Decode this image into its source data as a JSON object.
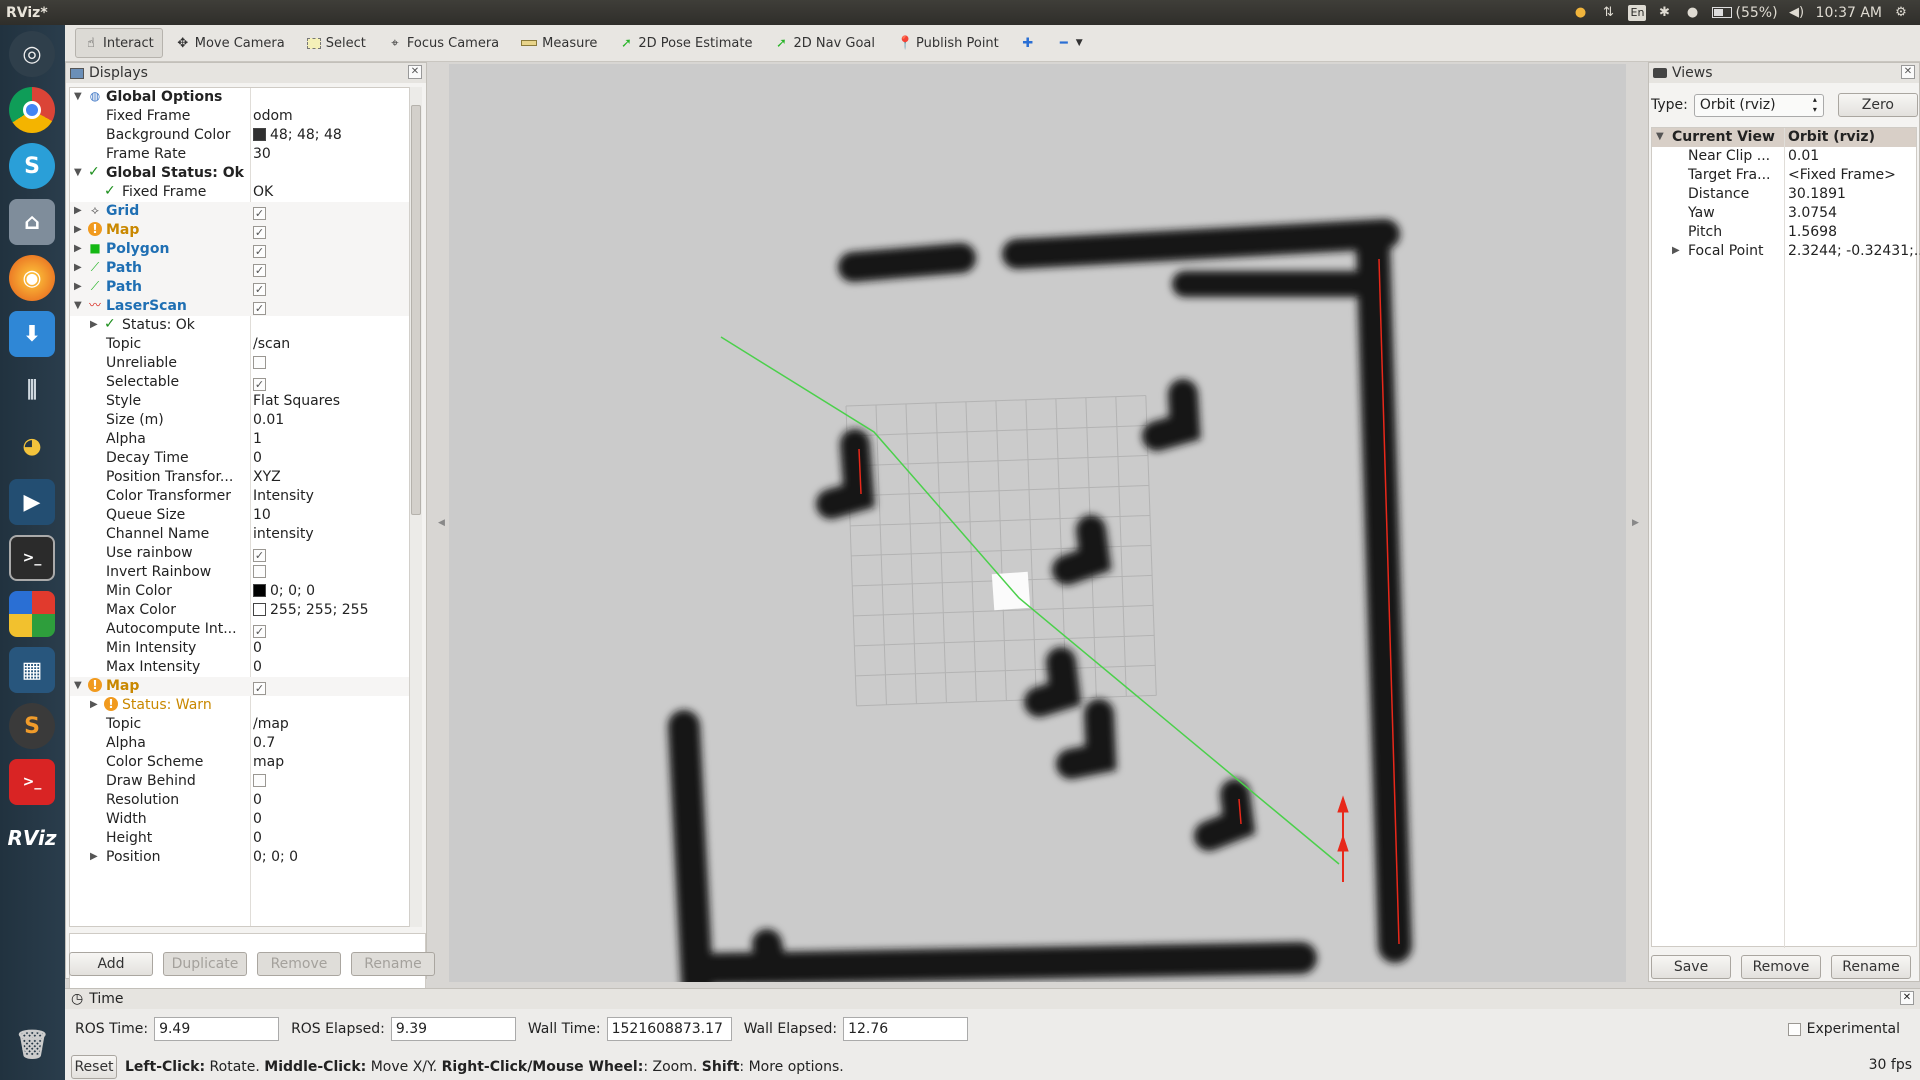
{
  "app_title": "RViz*",
  "tray": {
    "battery": "(55%)",
    "clock": "10:37 AM",
    "keyboard": "En"
  },
  "toolbar": {
    "tools": [
      {
        "label": "Interact",
        "icon": "hand-pointer-icon",
        "active": true
      },
      {
        "label": "Move Camera",
        "icon": "move-arrows-icon"
      },
      {
        "label": "Select",
        "icon": "select-box-icon"
      },
      {
        "label": "Focus Camera",
        "icon": "crosshair-icon"
      },
      {
        "label": "Measure",
        "icon": "ruler-icon"
      },
      {
        "label": "2D Pose Estimate",
        "icon": "green-arrow-icon"
      },
      {
        "label": "2D Nav Goal",
        "icon": "green-arrow-icon"
      },
      {
        "label": "Publish Point",
        "icon": "map-pin-icon"
      }
    ]
  },
  "displays": {
    "title": "Displays",
    "rows": [
      {
        "indent": 0,
        "arrow": "▼",
        "icon": "globe-icon",
        "name": "Global Options",
        "val": "",
        "cls": ""
      },
      {
        "indent": 1,
        "name": "Fixed Frame",
        "val": "odom"
      },
      {
        "indent": 1,
        "name": "Background Color",
        "val": "48; 48; 48",
        "swatch": "#303030"
      },
      {
        "indent": 1,
        "name": "Frame Rate",
        "val": "30"
      },
      {
        "indent": 0,
        "arrow": "▼",
        "check": true,
        "name": "Global Status: Ok",
        "val": "",
        "cls": ""
      },
      {
        "indent": 1,
        "check": true,
        "name": "Fixed Frame",
        "val": "OK"
      },
      {
        "indent": 0,
        "arrow": "▶",
        "icon": "grid-icon",
        "name": "Grid",
        "val": "",
        "box": true,
        "cls": "blue"
      },
      {
        "indent": 0,
        "arrow": "▶",
        "icon": "warn-icon",
        "name": "Map",
        "val": "",
        "box": true,
        "cls": "orange"
      },
      {
        "indent": 0,
        "arrow": "▶",
        "icon": "polygon-icon",
        "name": "Polygon",
        "val": "",
        "box": true,
        "cls": "blue"
      },
      {
        "indent": 0,
        "arrow": "▶",
        "icon": "path-icon",
        "name": "Path",
        "val": "",
        "box": true,
        "cls": "blue"
      },
      {
        "indent": 0,
        "arrow": "▶",
        "icon": "path-icon",
        "name": "Path",
        "val": "",
        "box": true,
        "cls": "blue"
      },
      {
        "indent": 0,
        "arrow": "▼",
        "icon": "laserscan-icon",
        "name": "LaserScan",
        "val": "",
        "box": true,
        "cls": "blue"
      },
      {
        "indent": 1,
        "arrow": "▶",
        "check": true,
        "name": "Status: Ok",
        "val": ""
      },
      {
        "indent": 1,
        "name": "Topic",
        "val": "/scan"
      },
      {
        "indent": 1,
        "name": "Unreliable",
        "val": "",
        "box": false
      },
      {
        "indent": 1,
        "name": "Selectable",
        "val": "",
        "box": true
      },
      {
        "indent": 1,
        "name": "Style",
        "val": "Flat Squares"
      },
      {
        "indent": 1,
        "name": "Size (m)",
        "val": "0.01"
      },
      {
        "indent": 1,
        "name": "Alpha",
        "val": "1"
      },
      {
        "indent": 1,
        "name": "Decay Time",
        "val": "0"
      },
      {
        "indent": 1,
        "name": "Position Transfor...",
        "val": "XYZ"
      },
      {
        "indent": 1,
        "name": "Color Transformer",
        "val": "Intensity"
      },
      {
        "indent": 1,
        "name": "Queue Size",
        "val": "10"
      },
      {
        "indent": 1,
        "name": "Channel Name",
        "val": "intensity"
      },
      {
        "indent": 1,
        "name": "Use rainbow",
        "val": "",
        "box": true
      },
      {
        "indent": 1,
        "name": "Invert Rainbow",
        "val": "",
        "box": false
      },
      {
        "indent": 1,
        "name": "Min Color",
        "val": "0; 0; 0",
        "swatch": "#000000"
      },
      {
        "indent": 1,
        "name": "Max Color",
        "val": "255; 255; 255",
        "swatch": "#ffffff"
      },
      {
        "indent": 1,
        "name": "Autocompute Int...",
        "val": "",
        "box": true
      },
      {
        "indent": 1,
        "name": "Min Intensity",
        "val": "0"
      },
      {
        "indent": 1,
        "name": "Max Intensity",
        "val": "0"
      },
      {
        "indent": 0,
        "arrow": "▼",
        "icon": "warn-icon",
        "name": "Map",
        "val": "",
        "box": true,
        "cls": "orange"
      },
      {
        "indent": 1,
        "arrow": "▶",
        "icon": "warn-icon",
        "name": "Status: Warn",
        "val": "",
        "cls": "orange-normal"
      },
      {
        "indent": 1,
        "name": "Topic",
        "val": "/map"
      },
      {
        "indent": 1,
        "name": "Alpha",
        "val": "0.7"
      },
      {
        "indent": 1,
        "name": "Color Scheme",
        "val": "map"
      },
      {
        "indent": 1,
        "name": "Draw Behind",
        "val": "",
        "box": false
      },
      {
        "indent": 1,
        "name": "Resolution",
        "val": "0"
      },
      {
        "indent": 1,
        "name": "Width",
        "val": "0"
      },
      {
        "indent": 1,
        "name": "Height",
        "val": "0"
      },
      {
        "indent": 1,
        "arrow": "▶",
        "name": "Position",
        "val": "0; 0; 0"
      }
    ],
    "buttons": {
      "add": "Add",
      "duplicate": "Duplicate",
      "remove": "Remove",
      "rename": "Rename"
    }
  },
  "views": {
    "title": "Views",
    "type_label": "Type:",
    "type_value": "Orbit (rviz)",
    "zero": "Zero",
    "header": {
      "name": "Current View",
      "val": "Orbit (rviz)"
    },
    "rows": [
      {
        "name": "Near Clip ...",
        "val": "0.01"
      },
      {
        "name": "Target Fra...",
        "val": "<Fixed Frame>"
      },
      {
        "name": "Distance",
        "val": "30.1891"
      },
      {
        "name": "Yaw",
        "val": "3.0754"
      },
      {
        "name": "Pitch",
        "val": "1.5698"
      },
      {
        "name": "Focal Point",
        "val": "2.3244; -0.32431;...",
        "arrow": "▶"
      }
    ],
    "buttons": {
      "save": "Save",
      "remove": "Remove",
      "rename": "Rename"
    }
  },
  "time": {
    "title": "Time",
    "ros_time_label": "ROS Time:",
    "ros_time": "9.49",
    "ros_elapsed_label": "ROS Elapsed:",
    "ros_elapsed": "9.39",
    "wall_time_label": "Wall Time:",
    "wall_time": "1521608873.17",
    "wall_elapsed_label": "Wall Elapsed:",
    "wall_elapsed": "12.76",
    "experimental": "Experimental",
    "reset": "Reset",
    "help_b1": "Left-Click:",
    "help_t1": "Rotate.",
    "help_b2": "Middle-Click:",
    "help_t2": "Move X/Y.",
    "help_b3": "Right-Click/Mouse Wheel:",
    "help_t3": ": Zoom.",
    "help_b4": "Shift",
    "help_t4": ": More options.",
    "fps": "30 fps"
  },
  "colors": {
    "map_gray": "#cbcbcb",
    "obstacle": "#141414",
    "laser": "#e8281a",
    "path": "#4bd04b"
  }
}
